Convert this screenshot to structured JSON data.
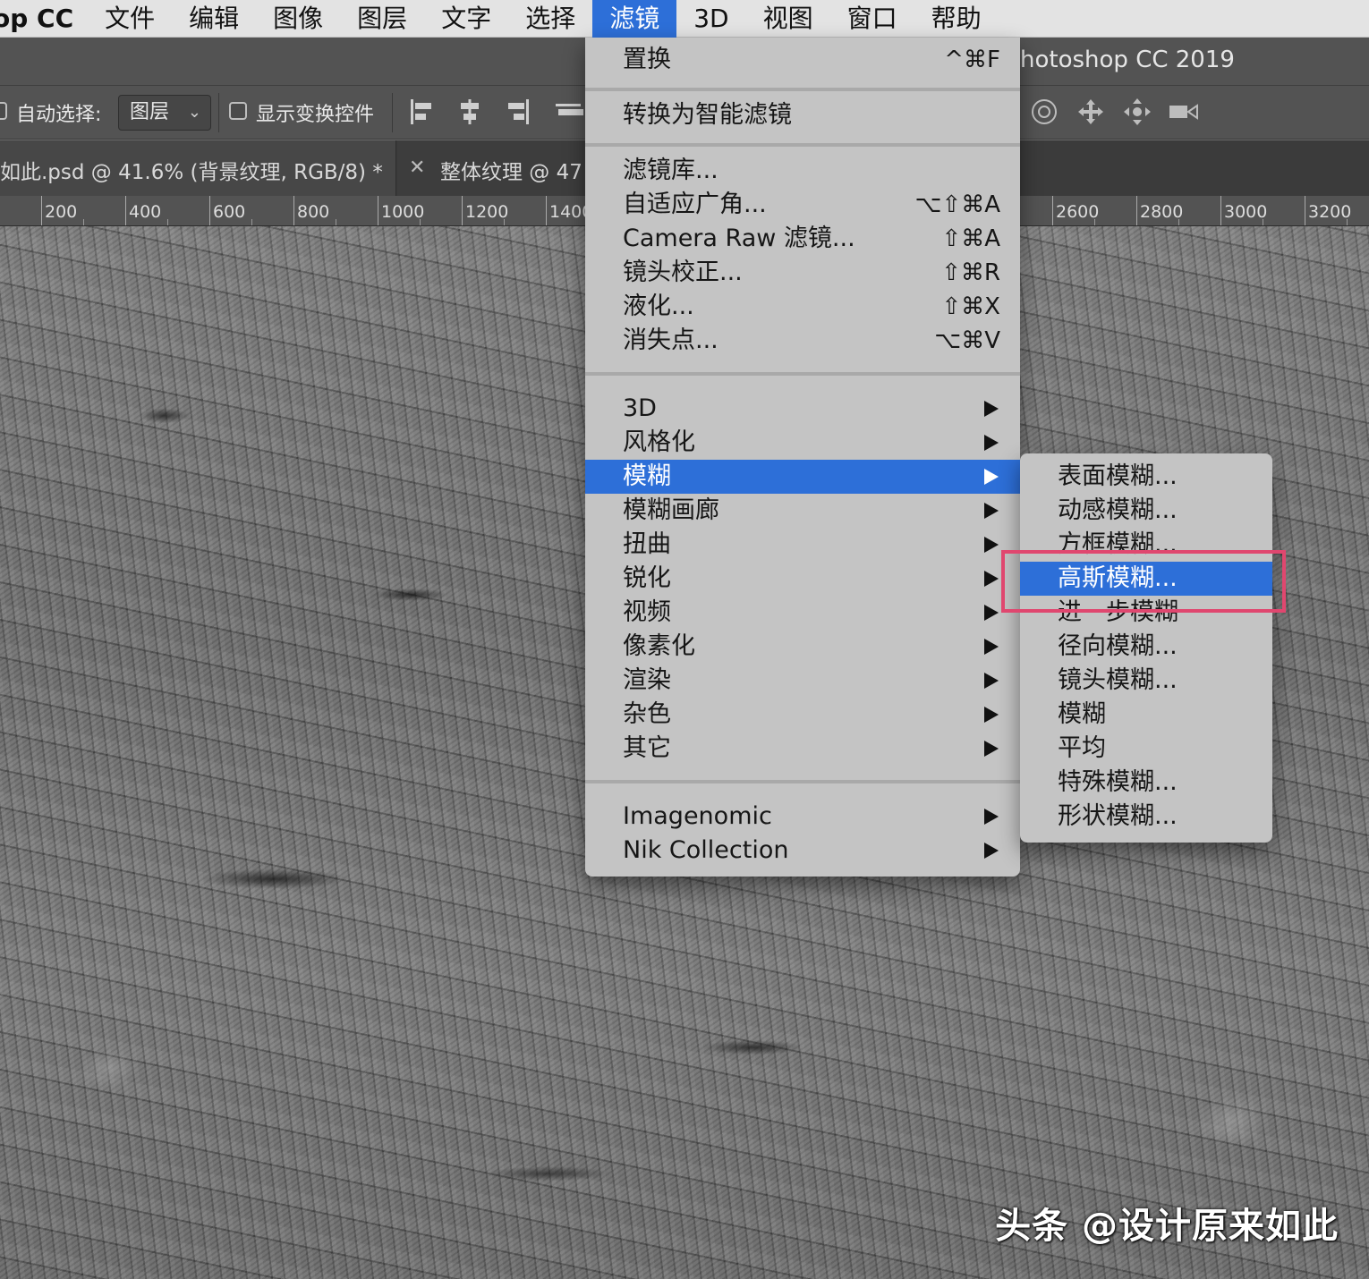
{
  "menubar": {
    "app_name": "op CC",
    "items": [
      "文件",
      "编辑",
      "图像",
      "图层",
      "文字",
      "选择",
      "滤镜",
      "3D",
      "视图",
      "窗口",
      "帮助"
    ],
    "active_index": 6
  },
  "titlebar": {
    "title": "hotoshop CC 2019"
  },
  "options": {
    "auto_select_label": "自动选择:",
    "auto_select_value": "图层",
    "show_transform_label": "显示变换控件"
  },
  "tabs": [
    {
      "label": "如此.psd @ 41.6% (背景纹理, RGB/8) *",
      "active": true
    },
    {
      "label": "整体纹理 @ 47",
      "active": false
    }
  ],
  "ruler": {
    "labels": [
      "200",
      "400",
      "600",
      "800",
      "1000",
      "1200",
      "1400",
      "2600",
      "2800",
      "3000",
      "3200"
    ]
  },
  "filter_menu": {
    "groups": [
      [
        {
          "label": "置换",
          "shortcut": "^⌘F"
        }
      ],
      [
        {
          "label": "转换为智能滤镜"
        }
      ],
      [
        {
          "label": "滤镜库..."
        },
        {
          "label": "自适应广角...",
          "shortcut": "⌥⇧⌘A"
        },
        {
          "label": "Camera Raw 滤镜...",
          "shortcut": "⇧⌘A"
        },
        {
          "label": "镜头校正...",
          "shortcut": "⇧⌘R"
        },
        {
          "label": "液化...",
          "shortcut": "⇧⌘X"
        },
        {
          "label": "消失点...",
          "shortcut": "⌥⌘V"
        }
      ],
      [
        {
          "label": "3D",
          "submenu": true
        },
        {
          "label": "风格化",
          "submenu": true
        },
        {
          "label": "模糊",
          "submenu": true,
          "highlighted": true
        },
        {
          "label": "模糊画廊",
          "submenu": true
        },
        {
          "label": "扭曲",
          "submenu": true
        },
        {
          "label": "锐化",
          "submenu": true
        },
        {
          "label": "视频",
          "submenu": true
        },
        {
          "label": "像素化",
          "submenu": true
        },
        {
          "label": "渲染",
          "submenu": true
        },
        {
          "label": "杂色",
          "submenu": true
        },
        {
          "label": "其它",
          "submenu": true
        }
      ],
      [
        {
          "label": "Imagenomic",
          "submenu": true
        },
        {
          "label": "Nik Collection",
          "submenu": true
        }
      ]
    ]
  },
  "blur_submenu": {
    "items": [
      {
        "label": "表面模糊..."
      },
      {
        "label": "动感模糊..."
      },
      {
        "label": "方框模糊..."
      },
      {
        "label": "高斯模糊...",
        "highlighted": true
      },
      {
        "label": "进一步模糊"
      },
      {
        "label": "径向模糊..."
      },
      {
        "label": "镜头模糊..."
      },
      {
        "label": "模糊"
      },
      {
        "label": "平均"
      },
      {
        "label": "特殊模糊..."
      },
      {
        "label": "形状模糊..."
      }
    ]
  },
  "watermark": "头条 @设计原来如此",
  "colors": {
    "accent": "#2d6fd8",
    "annotation": "#e0476f",
    "menu_bg": "#c4c4c4"
  }
}
